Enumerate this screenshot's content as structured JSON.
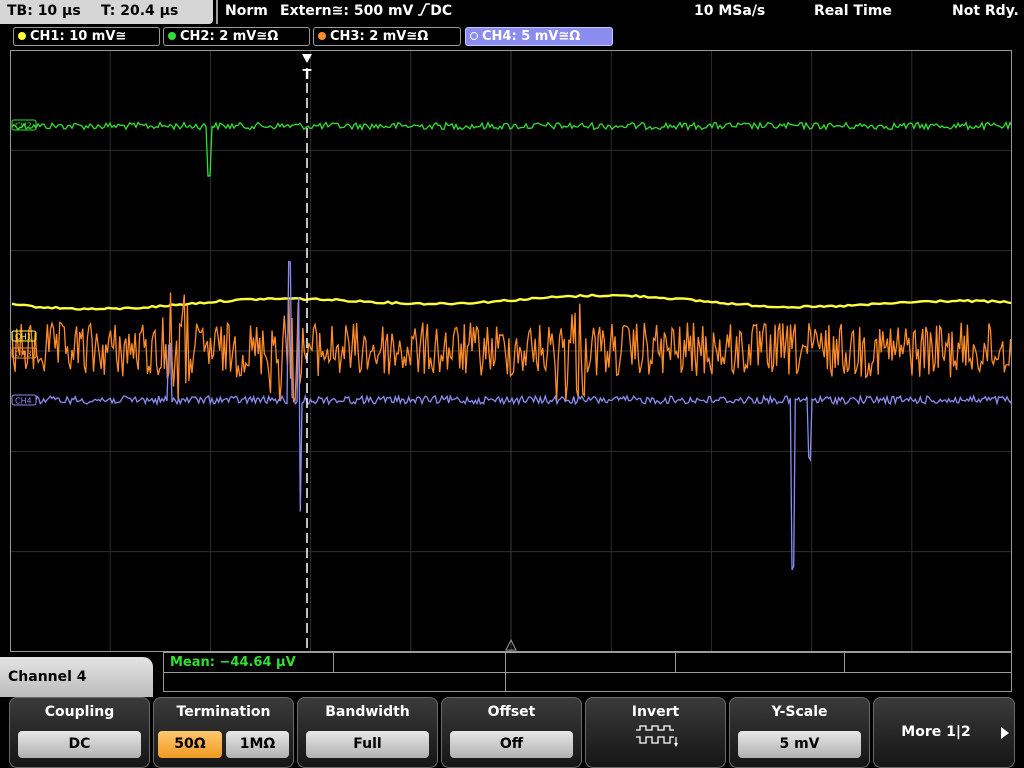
{
  "status_bar": {
    "timebase": "TB: 10 µs",
    "trigger_time": "T: 20.4 µs",
    "trigger_mode": "Norm",
    "trigger_source": "Extern≅: 500 mV",
    "trigger_edge_coupling": "DC",
    "sample_rate": "10 MSa/s",
    "acquisition_mode": "Real Time",
    "state": "Not Rdy."
  },
  "channels": [
    {
      "label": "CH1: 10 mV≅",
      "color": "#ffff3c"
    },
    {
      "label": "CH2: 2 mV≅Ω",
      "color": "#30e030"
    },
    {
      "label": "CH3: 2 mV≅Ω",
      "color": "#ff8c28"
    },
    {
      "label": "CH4: 5 mV≅Ω",
      "color": "#8a8cf0"
    }
  ],
  "trace_markers": {
    "ch1": "CH1",
    "ch2": "CH2",
    "ch3": "CH3",
    "ch4": "CH4"
  },
  "trigger_marker": "T",
  "measurement": {
    "text": "Mean: −44.64 µV",
    "color": "#30e030"
  },
  "channel_panel": {
    "title": "Channel 4"
  },
  "softkeys": {
    "coupling": {
      "title": "Coupling",
      "value": "DC"
    },
    "termination": {
      "title": "Termination",
      "option_a": "50Ω",
      "option_b": "1MΩ"
    },
    "bandwidth": {
      "title": "Bandwidth",
      "value": "Full"
    },
    "offset": {
      "title": "Offset",
      "value": "Off"
    },
    "invert": {
      "title": "Invert",
      "icon": "invert-pulse-icon"
    },
    "y_scale": {
      "title": "Y-Scale",
      "value": "5 mV"
    },
    "more": {
      "label": "More 1|2",
      "icon": "arrow-right-icon"
    }
  }
}
